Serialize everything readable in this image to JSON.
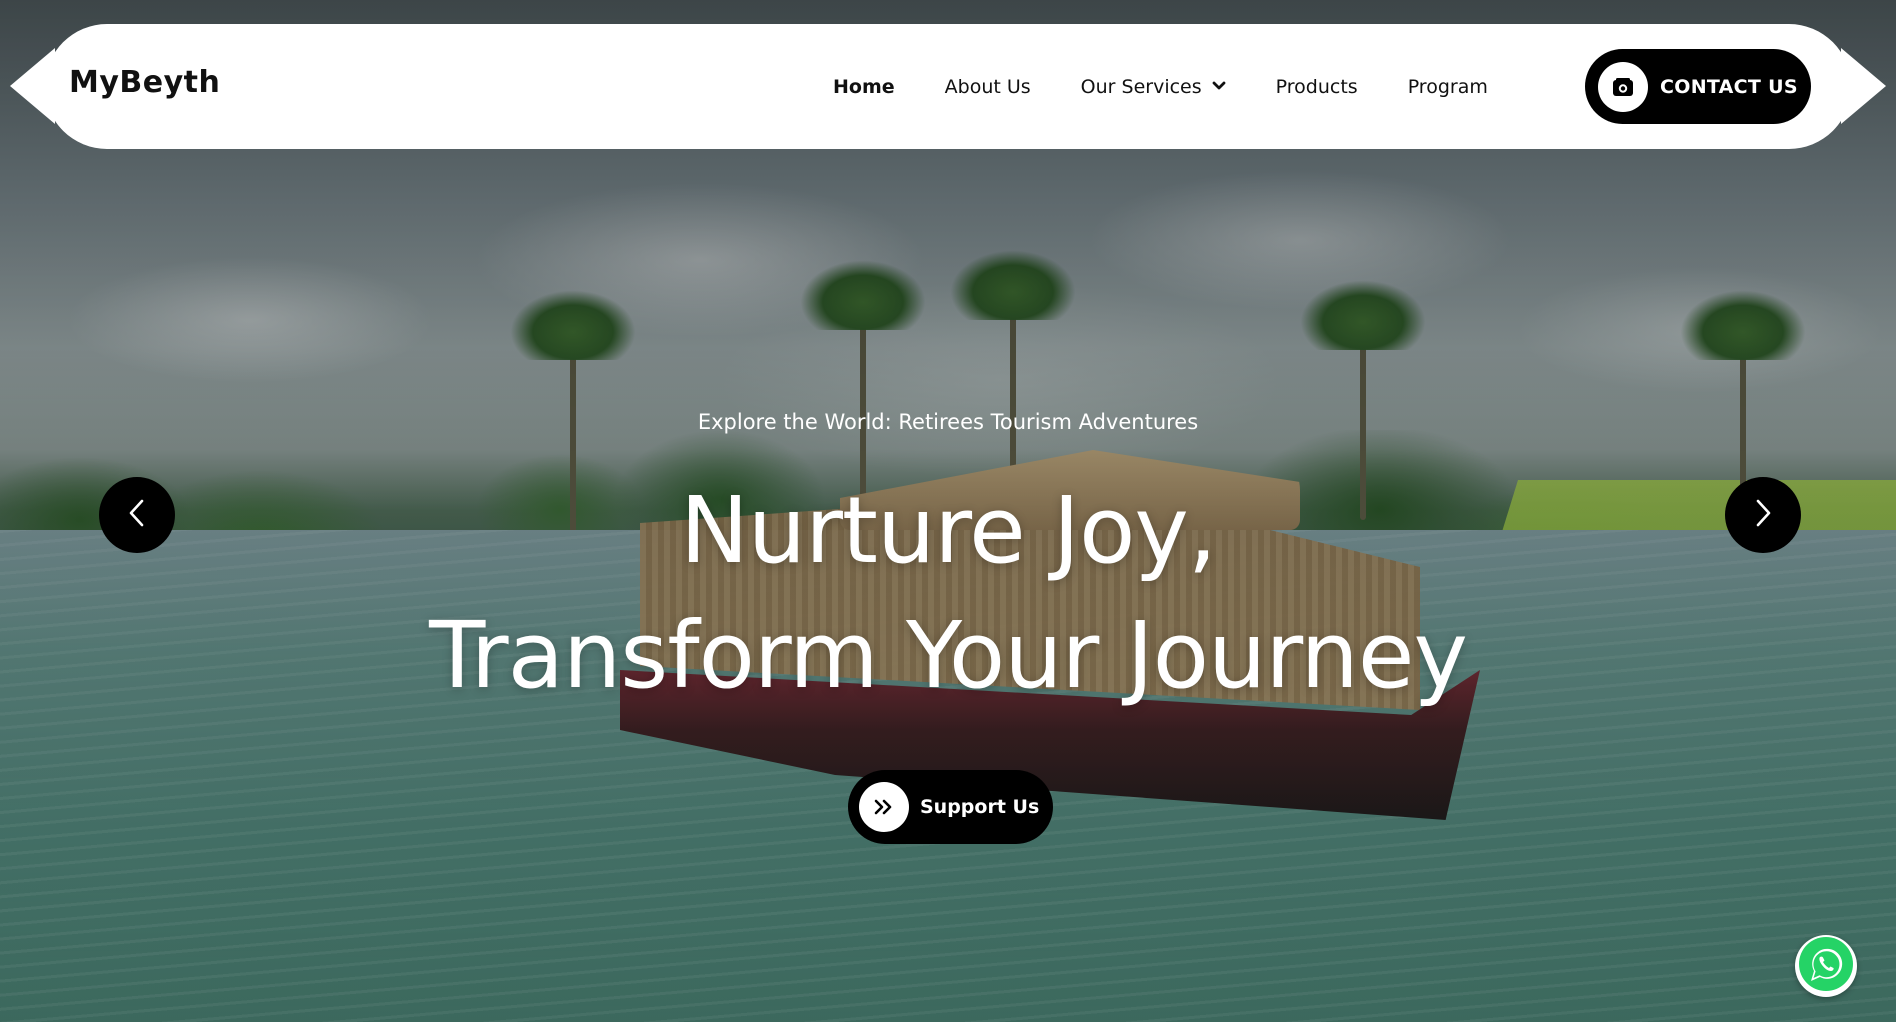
{
  "brand": {
    "logo": "MyBeyth"
  },
  "nav": {
    "items": [
      {
        "label": "Home",
        "active": true
      },
      {
        "label": "About Us"
      },
      {
        "label": "Our Services",
        "has_dropdown": true
      },
      {
        "label": "Products"
      },
      {
        "label": "Program"
      }
    ],
    "contact_label": "CONTACT US"
  },
  "hero": {
    "tagline": "Explore the World: Retirees Tourism Adventures",
    "headline_line1": "Nurture Joy,",
    "headline_line2": "Transform Your Journey",
    "cta_label": "Support Us"
  },
  "icons": {
    "contact": "camera-icon",
    "cta": "double-chevron-right-icon",
    "prev": "chevron-left-icon",
    "next": "chevron-right-icon",
    "chat": "whatsapp-icon"
  },
  "colors": {
    "header_bg": "#ffffff",
    "button_bg": "#000000",
    "text_dark": "#111111",
    "text_light": "#ffffff",
    "whatsapp_green": "#25d366"
  }
}
